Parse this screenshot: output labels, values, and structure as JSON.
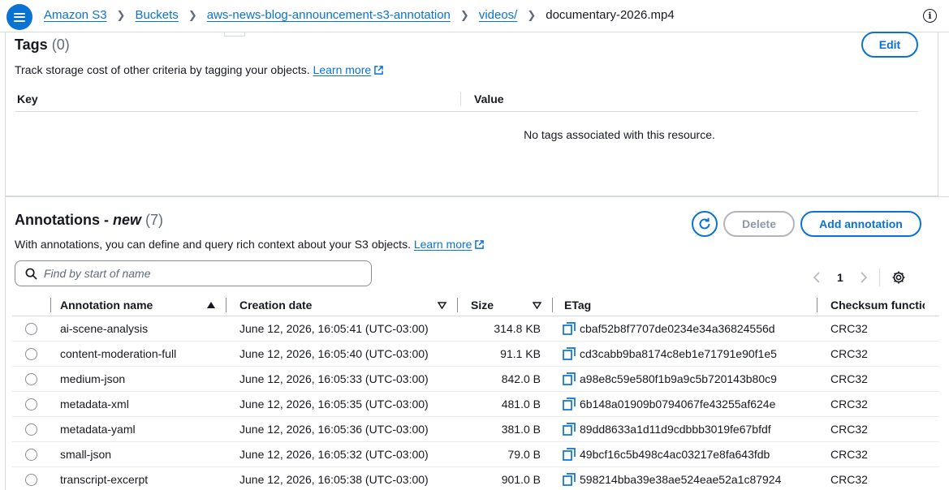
{
  "breadcrumb": {
    "items": [
      "Amazon S3",
      "Buckets",
      "aws-news-blog-announcement-s3-annotation",
      "videos/"
    ],
    "current": "documentary-2026.mp4"
  },
  "tags": {
    "title": "Tags",
    "count": "(0)",
    "edit_label": "Edit",
    "description": "Track storage cost of other criteria by tagging your objects.",
    "learn_more": "Learn more",
    "columns": {
      "key": "Key",
      "value": "Value"
    },
    "empty_message": "No tags associated with this resource."
  },
  "annotations": {
    "title": "Annotations - ",
    "title_badge": "new",
    "count": "(7)",
    "description": "With annotations, you can define and query rich context about your S3 objects.",
    "learn_more": "Learn more",
    "delete_label": "Delete",
    "add_label": "Add annotation",
    "search_placeholder": "Find by start of name",
    "page_number": "1",
    "columns": {
      "name": "Annotation name",
      "date": "Creation date",
      "size": "Size",
      "etag": "ETag",
      "checksum": "Checksum function"
    },
    "rows": [
      {
        "name": "ai-scene-analysis",
        "date": "June 12, 2026, 16:05:41 (UTC-03:00)",
        "size": "314.8 KB",
        "etag": "cbaf52b8f7707de0234e34a36824556d",
        "checksum": "CRC32"
      },
      {
        "name": "content-moderation-full",
        "date": "June 12, 2026, 16:05:40 (UTC-03:00)",
        "size": "91.1 KB",
        "etag": "cd3cabb9ba8174c8eb1e71791e90f1e5",
        "checksum": "CRC32"
      },
      {
        "name": "medium-json",
        "date": "June 12, 2026, 16:05:33 (UTC-03:00)",
        "size": "842.0 B",
        "etag": "a98e8c59e580f1b9a9c5b720143b80c9",
        "checksum": "CRC32"
      },
      {
        "name": "metadata-xml",
        "date": "June 12, 2026, 16:05:35 (UTC-03:00)",
        "size": "481.0 B",
        "etag": "6b148a01909b0794067fe43255af624e",
        "checksum": "CRC32"
      },
      {
        "name": "metadata-yaml",
        "date": "June 12, 2026, 16:05:36 (UTC-03:00)",
        "size": "381.0 B",
        "etag": "89dd8633a1d11d9cdbbb3019fe67bfdf",
        "checksum": "CRC32"
      },
      {
        "name": "small-json",
        "date": "June 12, 2026, 16:05:32 (UTC-03:00)",
        "size": "79.0 B",
        "etag": "49bcf16c5b498c4ac03217e8fa643fdb",
        "checksum": "CRC32"
      },
      {
        "name": "transcript-excerpt",
        "date": "June 12, 2026, 16:05:38 (UTC-03:00)",
        "size": "901.0 B",
        "etag": "598214bba39e38ae524eae52a1c87924",
        "checksum": "CRC32"
      }
    ]
  },
  "colors": {
    "link": "#0972d3",
    "text": "#16191f",
    "border": "#d5dbdb",
    "disabled": "#8d99a8"
  },
  "icons": {
    "menu": "hamburger-icon",
    "info": "info-icon",
    "external": "external-link-icon",
    "search": "search-icon",
    "refresh": "refresh-icon",
    "settings": "gear-icon",
    "copy": "copy-icon",
    "sort": "sort-caret-icon"
  }
}
